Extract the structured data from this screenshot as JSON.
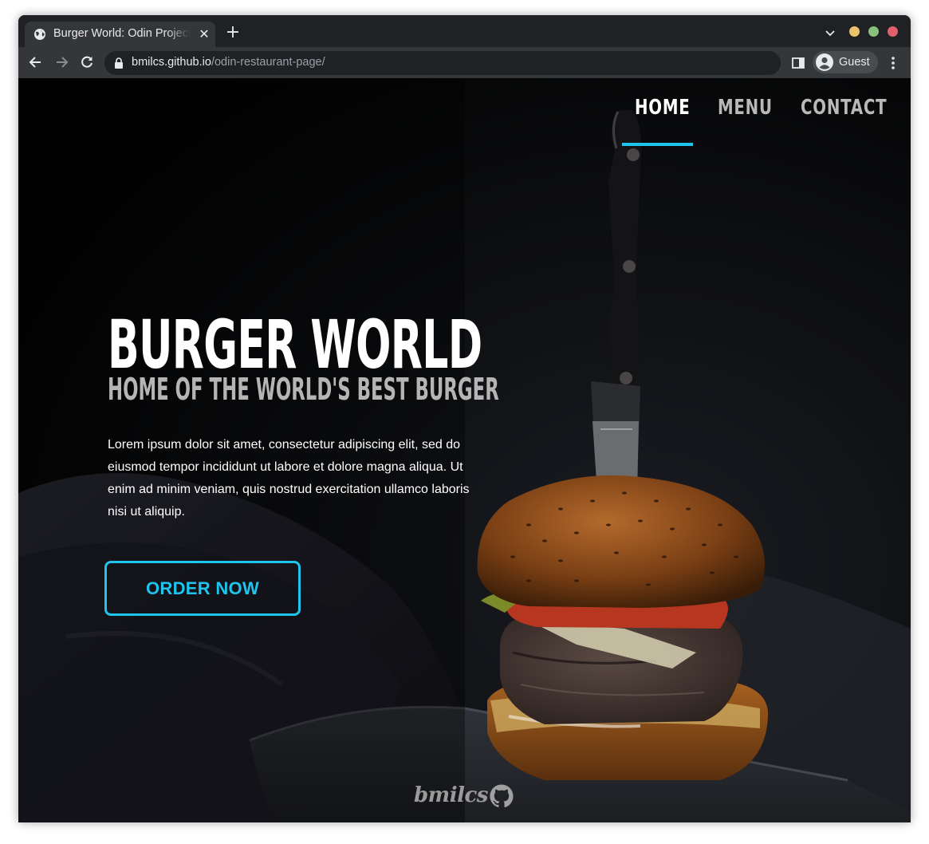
{
  "browser": {
    "tab_title": "Burger World: Odin Project",
    "url_host": "bmilcs.github.io",
    "url_path": "/odin-restaurant-page/",
    "profile_name": "Guest",
    "new_tab_glyph": "+",
    "close_tab_glyph": "✕"
  },
  "nav": {
    "items": [
      {
        "label": "HOME",
        "active": true
      },
      {
        "label": "MENU",
        "active": false
      },
      {
        "label": "CONTACT",
        "active": false
      }
    ],
    "accent_color": "#1ec4ec"
  },
  "hero": {
    "title": "BURGER WORLD",
    "subtitle": "HOME OF THE WORLD'S BEST BURGER",
    "body": "Lorem ipsum dolor sit amet, consectetur adipiscing elit, sed do eiusmod tempor incididunt ut labore et dolore magna aliqua. Ut enim ad minim veniam, quis nostrud exercitation ullamco laboris nisi ut aliquip.",
    "cta_label": "ORDER NOW"
  },
  "footer": {
    "signature": "bmilcs",
    "icon": "github-icon"
  }
}
